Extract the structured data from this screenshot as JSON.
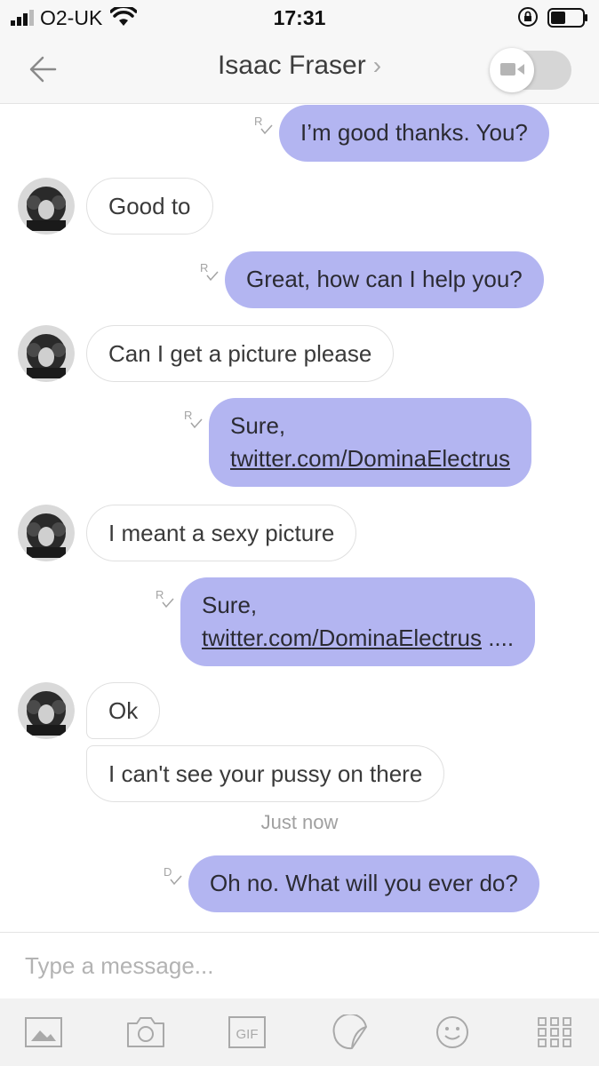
{
  "status_bar": {
    "carrier": "O2-UK",
    "time": "17:31"
  },
  "header": {
    "contact_name": "Isaac Fraser",
    "chevron": "›",
    "back_icon": "arrow-left-icon",
    "video_icon": "video-camera-icon"
  },
  "messages": [
    {
      "direction": "outgoing",
      "text": "I’m good thanks. You?",
      "receipt": "R"
    },
    {
      "direction": "incoming",
      "text": "Good to"
    },
    {
      "direction": "outgoing",
      "text": "Great, how can I help you?",
      "receipt": "R"
    },
    {
      "direction": "incoming",
      "text": "Can I get a picture please"
    },
    {
      "direction": "outgoing",
      "line1": "Sure,",
      "link": "twitter.com/DominaElectrus",
      "suffix": "",
      "receipt": "R"
    },
    {
      "direction": "incoming",
      "text": "I meant a sexy picture"
    },
    {
      "direction": "outgoing",
      "line1": "Sure,",
      "link": "twitter.com/DominaElectrus",
      "suffix": " ....",
      "receipt": "R"
    },
    {
      "direction": "incoming",
      "text": "Ok"
    },
    {
      "direction": "incoming",
      "text": "I can't see your pussy on there"
    },
    {
      "direction": "outgoing",
      "text": "Oh no. What will you ever do?",
      "receipt": "D"
    }
  ],
  "timestamp": "Just now",
  "composer": {
    "placeholder": "Type a message..."
  },
  "toolbar": {
    "gif_label": "GIF",
    "icons": [
      "image-icon",
      "camera-icon",
      "gif-icon",
      "sticker-icon",
      "emoji-icon",
      "grid-apps-icon"
    ]
  },
  "colors": {
    "outgoing_bubble": "#b3b5f1",
    "incoming_border": "#e0e0e0",
    "header_bg": "#f7f7f7"
  }
}
